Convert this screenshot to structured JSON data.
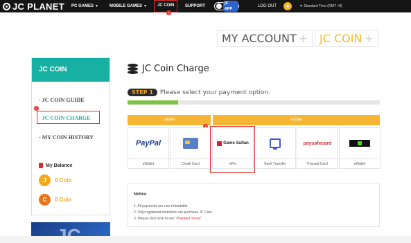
{
  "nav": {
    "logo": "JC PLANET",
    "pc_games": "PC GAMES",
    "mobile_games": "MOBILE GAMES",
    "jc_coin": "JC COIN",
    "support": "SUPPORT",
    "jc_app": "JC APP",
    "logout": "LOG OUT",
    "time": "Standard Time (GMT +8)",
    "step_marker": "1"
  },
  "header": {
    "my_account": "MY ACCOUNT",
    "jc_coin": "JC COIN",
    "plus": "+"
  },
  "sidebar": {
    "title": "JC COIN",
    "items": [
      {
        "label": "- JC COIN GUIDE"
      },
      {
        "label": "- JC COIN CHARGE"
      },
      {
        "label": "- MY COIN HISTORY"
      }
    ],
    "marker": "2",
    "balance_label": "My Balance",
    "balances": [
      {
        "icon": "J",
        "value": "0 Coin"
      },
      {
        "icon": "C",
        "value": "0 Coin"
      }
    ],
    "banner_text": "JC"
  },
  "main": {
    "title": "JC Coin Charge",
    "step_badge": "STEP 1",
    "step_text": "Please select your payment option.",
    "progress_percent": 20,
    "groups": [
      {
        "label": "J-Coin"
      },
      {
        "label": "C-Coin"
      }
    ],
    "marker": "3",
    "options": [
      {
        "logo_text": "PayPal",
        "caption": "eWallet"
      },
      {
        "logo_text": "CARD",
        "caption": "Credit Card"
      },
      {
        "logo_text": "Game Sultan",
        "caption": "ePin"
      },
      {
        "logo_text": "",
        "caption": "Bank Transfer"
      },
      {
        "logo_text": "paysafecard",
        "caption": "Prepaid Card"
      },
      {
        "logo_text": "",
        "caption": "eWallet"
      }
    ],
    "notice": {
      "title": "Notice",
      "line1": "1. All payments are non-refundable.",
      "line2": "2. Only registered members can purchase JC Coin.",
      "line3_prefix": "3. Please click here to see \"",
      "line3_link": "Payment Terms",
      "line3_suffix": "\""
    }
  },
  "colors": {
    "accent_teal": "#17b1a3",
    "accent_orange": "#f6b533",
    "highlight_red": "#e02a2a",
    "progress_green": "#7fc24a"
  }
}
